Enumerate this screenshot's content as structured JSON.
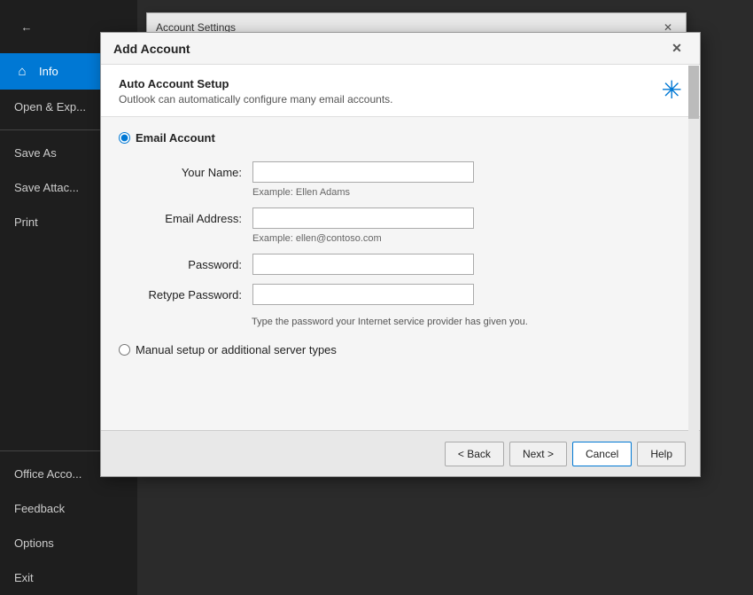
{
  "sidebar": {
    "back_icon": "←",
    "items": [
      {
        "id": "info",
        "label": "Info",
        "icon": "🏠",
        "active": true
      },
      {
        "id": "open-export",
        "label": "Open & Exp...",
        "icon": "",
        "active": false
      },
      {
        "id": "save-as",
        "label": "Save As",
        "icon": "",
        "active": false
      },
      {
        "id": "save-attachments",
        "label": "Save Attac...",
        "icon": "",
        "active": false
      },
      {
        "id": "print",
        "label": "Print",
        "icon": "",
        "active": false
      },
      {
        "id": "office-account",
        "label": "Office Acco...",
        "icon": "",
        "active": false
      },
      {
        "id": "feedback",
        "label": "Feedback",
        "icon": "",
        "active": false
      },
      {
        "id": "options",
        "label": "Options",
        "icon": "",
        "active": false
      },
      {
        "id": "exit",
        "label": "Exit",
        "icon": "",
        "active": false
      }
    ]
  },
  "bg_window": {
    "title": "Account Settings",
    "close_icon": "✕"
  },
  "modal": {
    "title": "Add Account",
    "close_icon": "✕",
    "auto_setup": {
      "title": "Auto Account Setup",
      "description": "Outlook can automatically configure many email accounts."
    },
    "email_account_label": "Email Account",
    "fields": {
      "your_name": {
        "label": "Your Name:",
        "placeholder": "",
        "hint": "Example: Ellen Adams"
      },
      "email_address": {
        "label": "Email Address:",
        "placeholder": "",
        "hint": "Example: ellen@contoso.com"
      },
      "password": {
        "label": "Password:",
        "placeholder": ""
      },
      "retype_password": {
        "label": "Retype Password:",
        "placeholder": ""
      }
    },
    "password_hint": "Type the password your Internet service provider has given you.",
    "manual_setup_label": "Manual setup or additional server types",
    "buttons": {
      "back": "< Back",
      "next": "Next >",
      "cancel": "Cancel",
      "help": "Help"
    }
  }
}
